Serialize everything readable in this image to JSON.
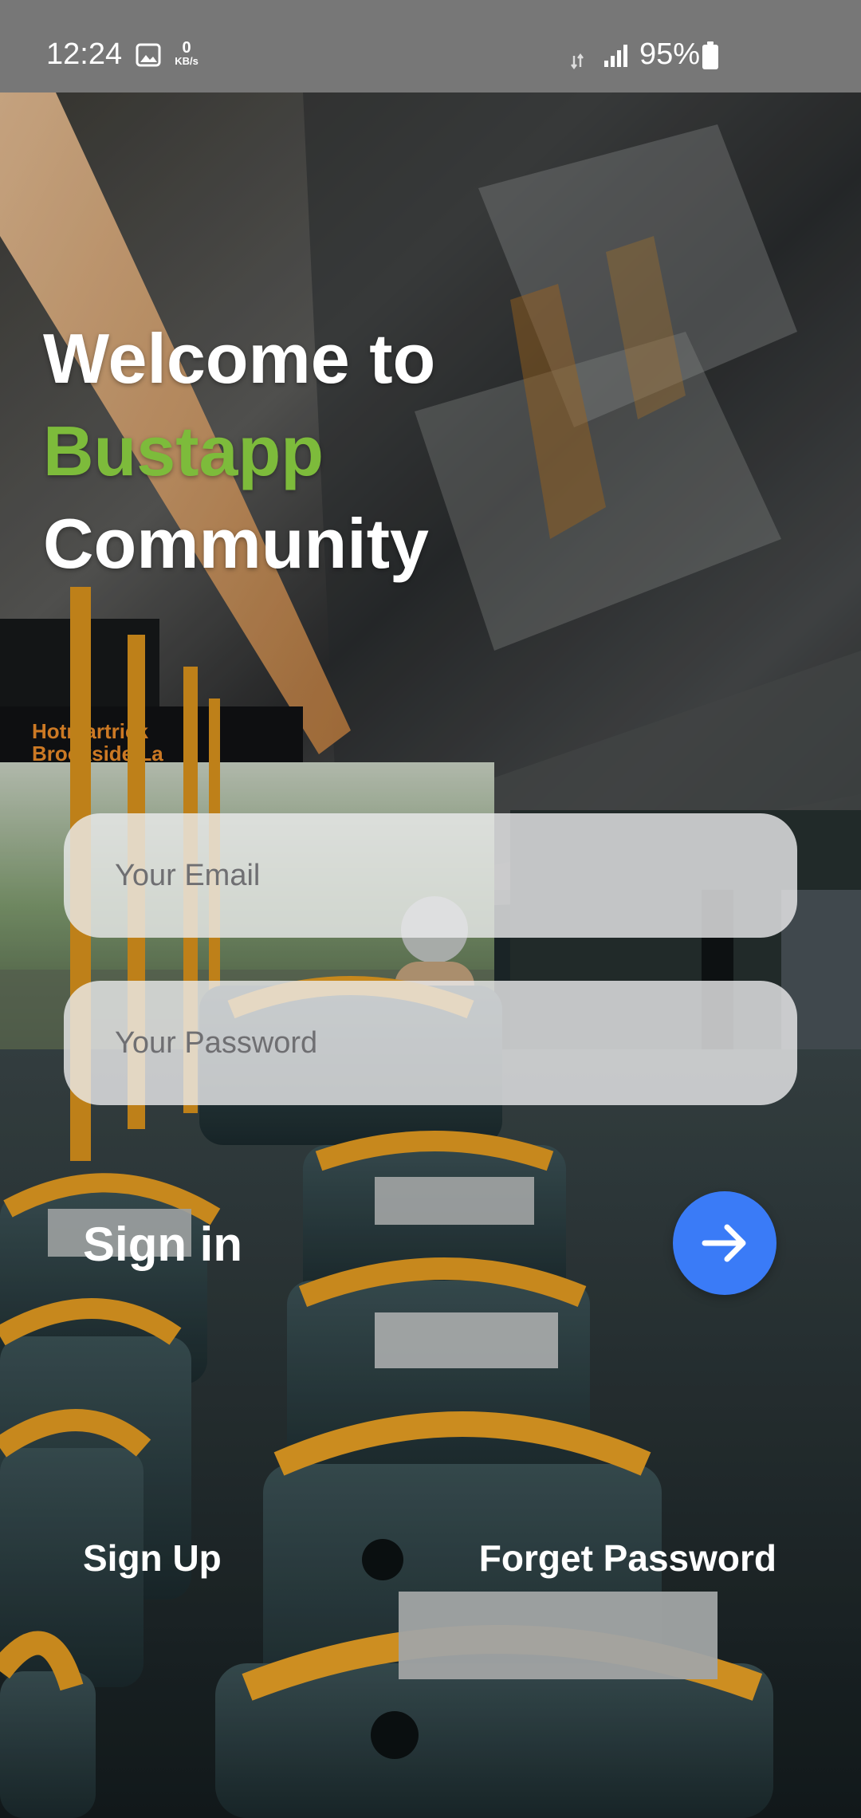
{
  "status_bar": {
    "time": "12:24",
    "net_speed_value": "0",
    "net_speed_unit": "KB/s",
    "battery": "95%",
    "icons": [
      "gallery-icon",
      "4g-data-icon",
      "signal-icon",
      "battery-icon"
    ]
  },
  "welcome": {
    "line1": "Welcome to",
    "brand": "Bustapp",
    "line3": "Community"
  },
  "form": {
    "email_placeholder": "Your Email",
    "email_value": "",
    "password_placeholder": "Your Password",
    "password_value": ""
  },
  "actions": {
    "sign_in_label": "Sign in",
    "sign_in_icon": "arrow-right-icon",
    "sign_up_label": "Sign Up",
    "forget_password_label": "Forget Password"
  },
  "colors": {
    "brand_green": "#7dbb3b",
    "accent_blue": "#3a7bf7",
    "status_bar_bg": "#777777",
    "field_bg": "#ececee"
  }
}
